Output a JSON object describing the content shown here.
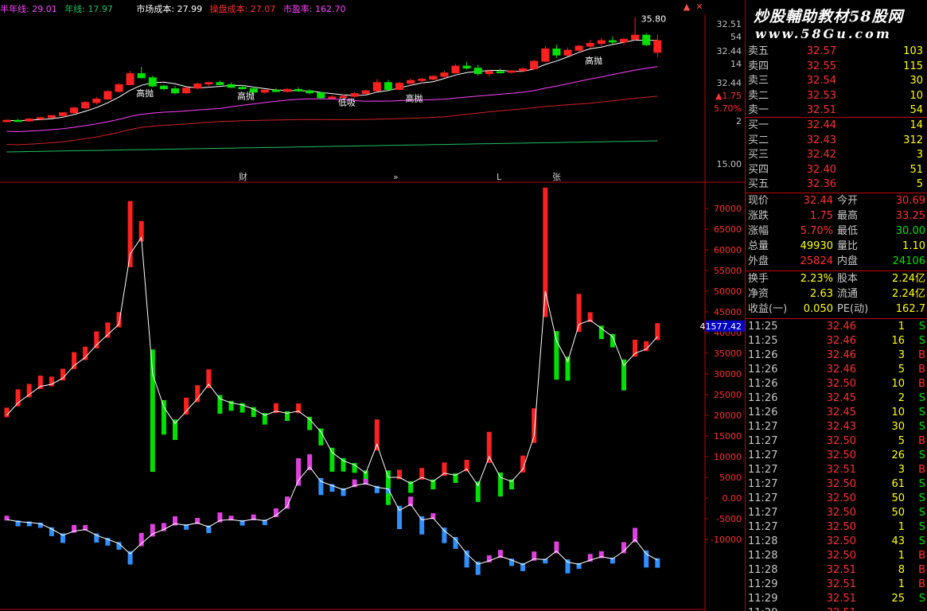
{
  "legend": {
    "half_year_line": "半年线: 29.01",
    "year_line": "年线: 17.97",
    "market_cost": "市场成本: 27.99",
    "operator_cost": "操盘成本: 27.07",
    "pe_ratio": "市盈率: 162.70"
  },
  "window_buttons": {
    "up": "▲",
    "close": "✕"
  },
  "kline_annotations": {
    "high_sell": "高抛",
    "low_buy": "低吸",
    "peak_price": "35.80"
  },
  "price_axis": {
    "labels": [
      "32.51",
      "54",
      "32.44",
      "14",
      "32.44",
      "▲1.75",
      "5.70%",
      "2",
      "15.00"
    ]
  },
  "info_bar": {
    "labels": [
      "财",
      "»",
      "L",
      "张"
    ]
  },
  "lower_axis": {
    "ticks": [
      "70000",
      "65000",
      "60000",
      "55000",
      "50000",
      "45000",
      "40000",
      "35000",
      "30000",
      "25000",
      "20000",
      "15000",
      "10000",
      "5000",
      "0.00",
      "-5000",
      "-10000"
    ],
    "cursor_value": "41577.42"
  },
  "watermark": {
    "title": "炒股輔助教材58股网",
    "url": "www.58Gu.com"
  },
  "order_book": {
    "asks": [
      {
        "label": "卖五",
        "price": "32.57",
        "volume": "103"
      },
      {
        "label": "卖四",
        "price": "32.55",
        "volume": "115"
      },
      {
        "label": "卖三",
        "price": "32.54",
        "volume": "30"
      },
      {
        "label": "卖二",
        "price": "32.53",
        "volume": "10"
      },
      {
        "label": "卖一",
        "price": "32.51",
        "volume": "54"
      }
    ],
    "bids": [
      {
        "label": "买一",
        "price": "32.44",
        "volume": "14"
      },
      {
        "label": "买二",
        "price": "32.43",
        "volume": "312"
      },
      {
        "label": "买三",
        "price": "32.42",
        "volume": "3"
      },
      {
        "label": "买四",
        "price": "32.40",
        "volume": "51"
      },
      {
        "label": "买五",
        "price": "32.36",
        "volume": "5"
      }
    ]
  },
  "quote": [
    {
      "k1": "现价",
      "v1": "32.44",
      "k2": "今开",
      "v2": "30.69"
    },
    {
      "k1": "涨跌",
      "v1": "1.75",
      "k2": "最高",
      "v2": "33.25"
    },
    {
      "k1": "涨幅",
      "v1": "5.70%",
      "k2": "最低",
      "v2": "30.00"
    },
    {
      "k1": "总量",
      "v1": "49930",
      "k2": "量比",
      "v2": "1.10"
    },
    {
      "k1": "外盘",
      "v1": "25824",
      "k2": "内盘",
      "v2": "24106"
    }
  ],
  "fundamentals": [
    {
      "k1": "换手",
      "v1": "2.23%",
      "k2": "股本",
      "v2": "2.24亿"
    },
    {
      "k1": "净资",
      "v1": "2.63",
      "k2": "流通",
      "v2": "2.24亿"
    },
    {
      "k1": "收益(一)",
      "v1": "0.050",
      "k2": "PE(动)",
      "v2": "162.7"
    }
  ],
  "ticks": [
    {
      "time": "11:25",
      "price": "32.46",
      "vol": "1",
      "side": "S"
    },
    {
      "time": "11:25",
      "price": "32.46",
      "vol": "16",
      "side": "S"
    },
    {
      "time": "11:26",
      "price": "32.46",
      "vol": "3",
      "side": "B"
    },
    {
      "time": "11:26",
      "price": "32.46",
      "vol": "5",
      "side": "B"
    },
    {
      "time": "11:26",
      "price": "32.50",
      "vol": "10",
      "side": "B"
    },
    {
      "time": "11:26",
      "price": "32.45",
      "vol": "2",
      "side": "S"
    },
    {
      "time": "11:26",
      "price": "32.45",
      "vol": "10",
      "side": "S"
    },
    {
      "time": "11:27",
      "price": "32.43",
      "vol": "30",
      "side": "S"
    },
    {
      "time": "11:27",
      "price": "32.50",
      "vol": "5",
      "side": "B"
    },
    {
      "time": "11:27",
      "price": "32.50",
      "vol": "26",
      "side": "S"
    },
    {
      "time": "11:27",
      "price": "32.51",
      "vol": "3",
      "side": "B"
    },
    {
      "time": "11:27",
      "price": "32.50",
      "vol": "61",
      "side": "S"
    },
    {
      "time": "11:27",
      "price": "32.50",
      "vol": "50",
      "side": "S"
    },
    {
      "time": "11:27",
      "price": "32.50",
      "vol": "50",
      "side": "S"
    },
    {
      "time": "11:27",
      "price": "32.50",
      "vol": "1",
      "side": "S"
    },
    {
      "time": "11:28",
      "price": "32.50",
      "vol": "43",
      "side": "S"
    },
    {
      "time": "11:28",
      "price": "32.50",
      "vol": "1",
      "side": "B"
    },
    {
      "time": "11:28",
      "price": "32.51",
      "vol": "8",
      "side": "B"
    },
    {
      "time": "11:29",
      "price": "32.51",
      "vol": "1",
      "side": "B"
    },
    {
      "time": "11:29",
      "price": "32.51",
      "vol": "25",
      "side": "S"
    },
    {
      "time": "11:29",
      "price": "32.51",
      "vol": "",
      "side": ""
    }
  ],
  "colors": {
    "up": "#ff2020",
    "down": "#00e000",
    "ma_white": "#ffffff",
    "ma_magenta": "#ff40ff",
    "ma_red": "#d02020",
    "ma_green": "#20c060",
    "grid": "#c00000"
  },
  "chart_data": {
    "type": "candlestick",
    "price_range": [
      14.0,
      36.0
    ],
    "candles": [
      [
        20.6,
        20.9,
        20.5,
        20.8
      ],
      [
        20.8,
        21.0,
        20.6,
        20.7
      ],
      [
        20.7,
        21.1,
        20.6,
        21.0
      ],
      [
        21.0,
        21.3,
        20.9,
        21.2
      ],
      [
        21.2,
        21.6,
        21.1,
        21.5
      ],
      [
        21.5,
        22.0,
        21.4,
        21.9
      ],
      [
        21.9,
        22.8,
        21.8,
        22.6
      ],
      [
        22.6,
        23.6,
        22.4,
        23.4
      ],
      [
        23.4,
        24.2,
        23.1,
        23.9
      ],
      [
        23.9,
        25.2,
        23.8,
        25.0
      ],
      [
        25.0,
        26.2,
        24.9,
        26.0
      ],
      [
        26.0,
        28.0,
        25.9,
        27.6
      ],
      [
        27.6,
        28.6,
        26.9,
        27.0
      ],
      [
        27.0,
        27.3,
        25.6,
        25.8
      ],
      [
        25.8,
        26.0,
        25.2,
        25.4
      ],
      [
        25.4,
        25.8,
        24.6,
        24.8
      ],
      [
        24.8,
        25.6,
        24.6,
        25.5
      ],
      [
        25.5,
        26.3,
        25.3,
        26.1
      ],
      [
        26.1,
        26.4,
        25.8,
        26.3
      ],
      [
        26.3,
        26.6,
        25.9,
        26.0
      ],
      [
        26.0,
        26.3,
        25.5,
        25.6
      ],
      [
        25.6,
        25.9,
        25.3,
        25.4
      ],
      [
        25.4,
        25.7,
        24.7,
        24.9
      ],
      [
        24.9,
        25.3,
        24.7,
        25.2
      ],
      [
        25.2,
        25.5,
        24.9,
        25.0
      ],
      [
        25.0,
        25.5,
        24.9,
        25.3
      ],
      [
        25.3,
        25.6,
        24.9,
        25.1
      ],
      [
        25.1,
        25.3,
        24.6,
        24.8
      ],
      [
        24.8,
        25.0,
        23.9,
        24.1
      ],
      [
        24.1,
        24.5,
        23.9,
        24.2
      ],
      [
        24.2,
        24.6,
        23.9,
        24.3
      ],
      [
        24.3,
        24.9,
        24.1,
        24.7
      ],
      [
        24.7,
        25.3,
        24.6,
        25.1
      ],
      [
        25.1,
        26.8,
        25.0,
        26.3
      ],
      [
        26.3,
        26.7,
        25.0,
        25.3
      ],
      [
        25.3,
        26.4,
        25.2,
        26.2
      ],
      [
        26.2,
        26.9,
        25.9,
        26.6
      ],
      [
        26.6,
        27.0,
        26.2,
        26.8
      ],
      [
        26.8,
        27.4,
        26.6,
        27.2
      ],
      [
        27.2,
        28.0,
        27.0,
        27.7
      ],
      [
        27.7,
        29.0,
        27.6,
        28.7
      ],
      [
        28.7,
        29.3,
        28.2,
        28.4
      ],
      [
        28.4,
        28.9,
        27.3,
        27.6
      ],
      [
        27.6,
        28.2,
        27.2,
        27.9
      ],
      [
        27.9,
        28.3,
        27.6,
        27.8
      ],
      [
        27.8,
        28.1,
        27.6,
        28.0
      ],
      [
        28.0,
        28.5,
        27.9,
        28.3
      ],
      [
        28.3,
        29.6,
        28.1,
        29.4
      ],
      [
        29.4,
        31.6,
        29.3,
        31.2
      ],
      [
        31.2,
        31.8,
        29.9,
        30.3
      ],
      [
        30.3,
        31.4,
        30.1,
        31.0
      ],
      [
        31.0,
        31.8,
        30.7,
        31.6
      ],
      [
        31.6,
        32.5,
        31.3,
        32.0
      ],
      [
        32.0,
        32.8,
        31.6,
        32.4
      ],
      [
        32.4,
        33.0,
        31.9,
        32.2
      ],
      [
        32.2,
        32.8,
        31.8,
        32.6
      ],
      [
        32.6,
        35.8,
        32.4,
        33.2
      ],
      [
        33.2,
        33.5,
        31.6,
        31.8
      ],
      [
        30.7,
        33.3,
        30.0,
        32.4
      ]
    ],
    "main_osc_values": [
      20000,
      23000,
      25000,
      27000,
      27500,
      29000,
      32000,
      34000,
      37000,
      39500,
      42000,
      59000,
      63000,
      30000,
      22000,
      18000,
      21000,
      24000,
      27500,
      24000,
      23000,
      22500,
      21500,
      20000,
      21000,
      20500,
      21000,
      19000,
      16000,
      11000,
      9000,
      8000,
      6000,
      13000,
      5000,
      5000,
      3500,
      5000,
      4000,
      6000,
      5500,
      7000,
      3000,
      10000,
      5000,
      4000,
      7000,
      15000,
      50000,
      38000,
      33000,
      42000,
      43000,
      41000,
      39000,
      32000,
      35000,
      36000,
      39000
    ],
    "secondary_osc_values": [
      -5200,
      -5700,
      -5900,
      -6200,
      -7500,
      -9000,
      -8000,
      -7600,
      -9000,
      -10000,
      -11000,
      -13500,
      -11000,
      -8700,
      -7600,
      -6200,
      -6600,
      -6000,
      -7000,
      -5400,
      -5200,
      -5600,
      -5100,
      -5500,
      -4200,
      -2000,
      4300,
      7500,
      4000,
      3000,
      2000,
      3000,
      3500,
      2600,
      2200,
      -3000,
      -1500,
      -5300,
      -4800,
      -7900,
      -10000,
      -13500,
      -16000,
      -15200,
      -14100,
      -15000,
      -16100,
      -14700,
      -14900,
      -12800,
      -15500,
      -16000,
      -15000,
      -14200,
      -14700,
      -12800,
      -10000,
      -13500,
      -15000
    ]
  }
}
